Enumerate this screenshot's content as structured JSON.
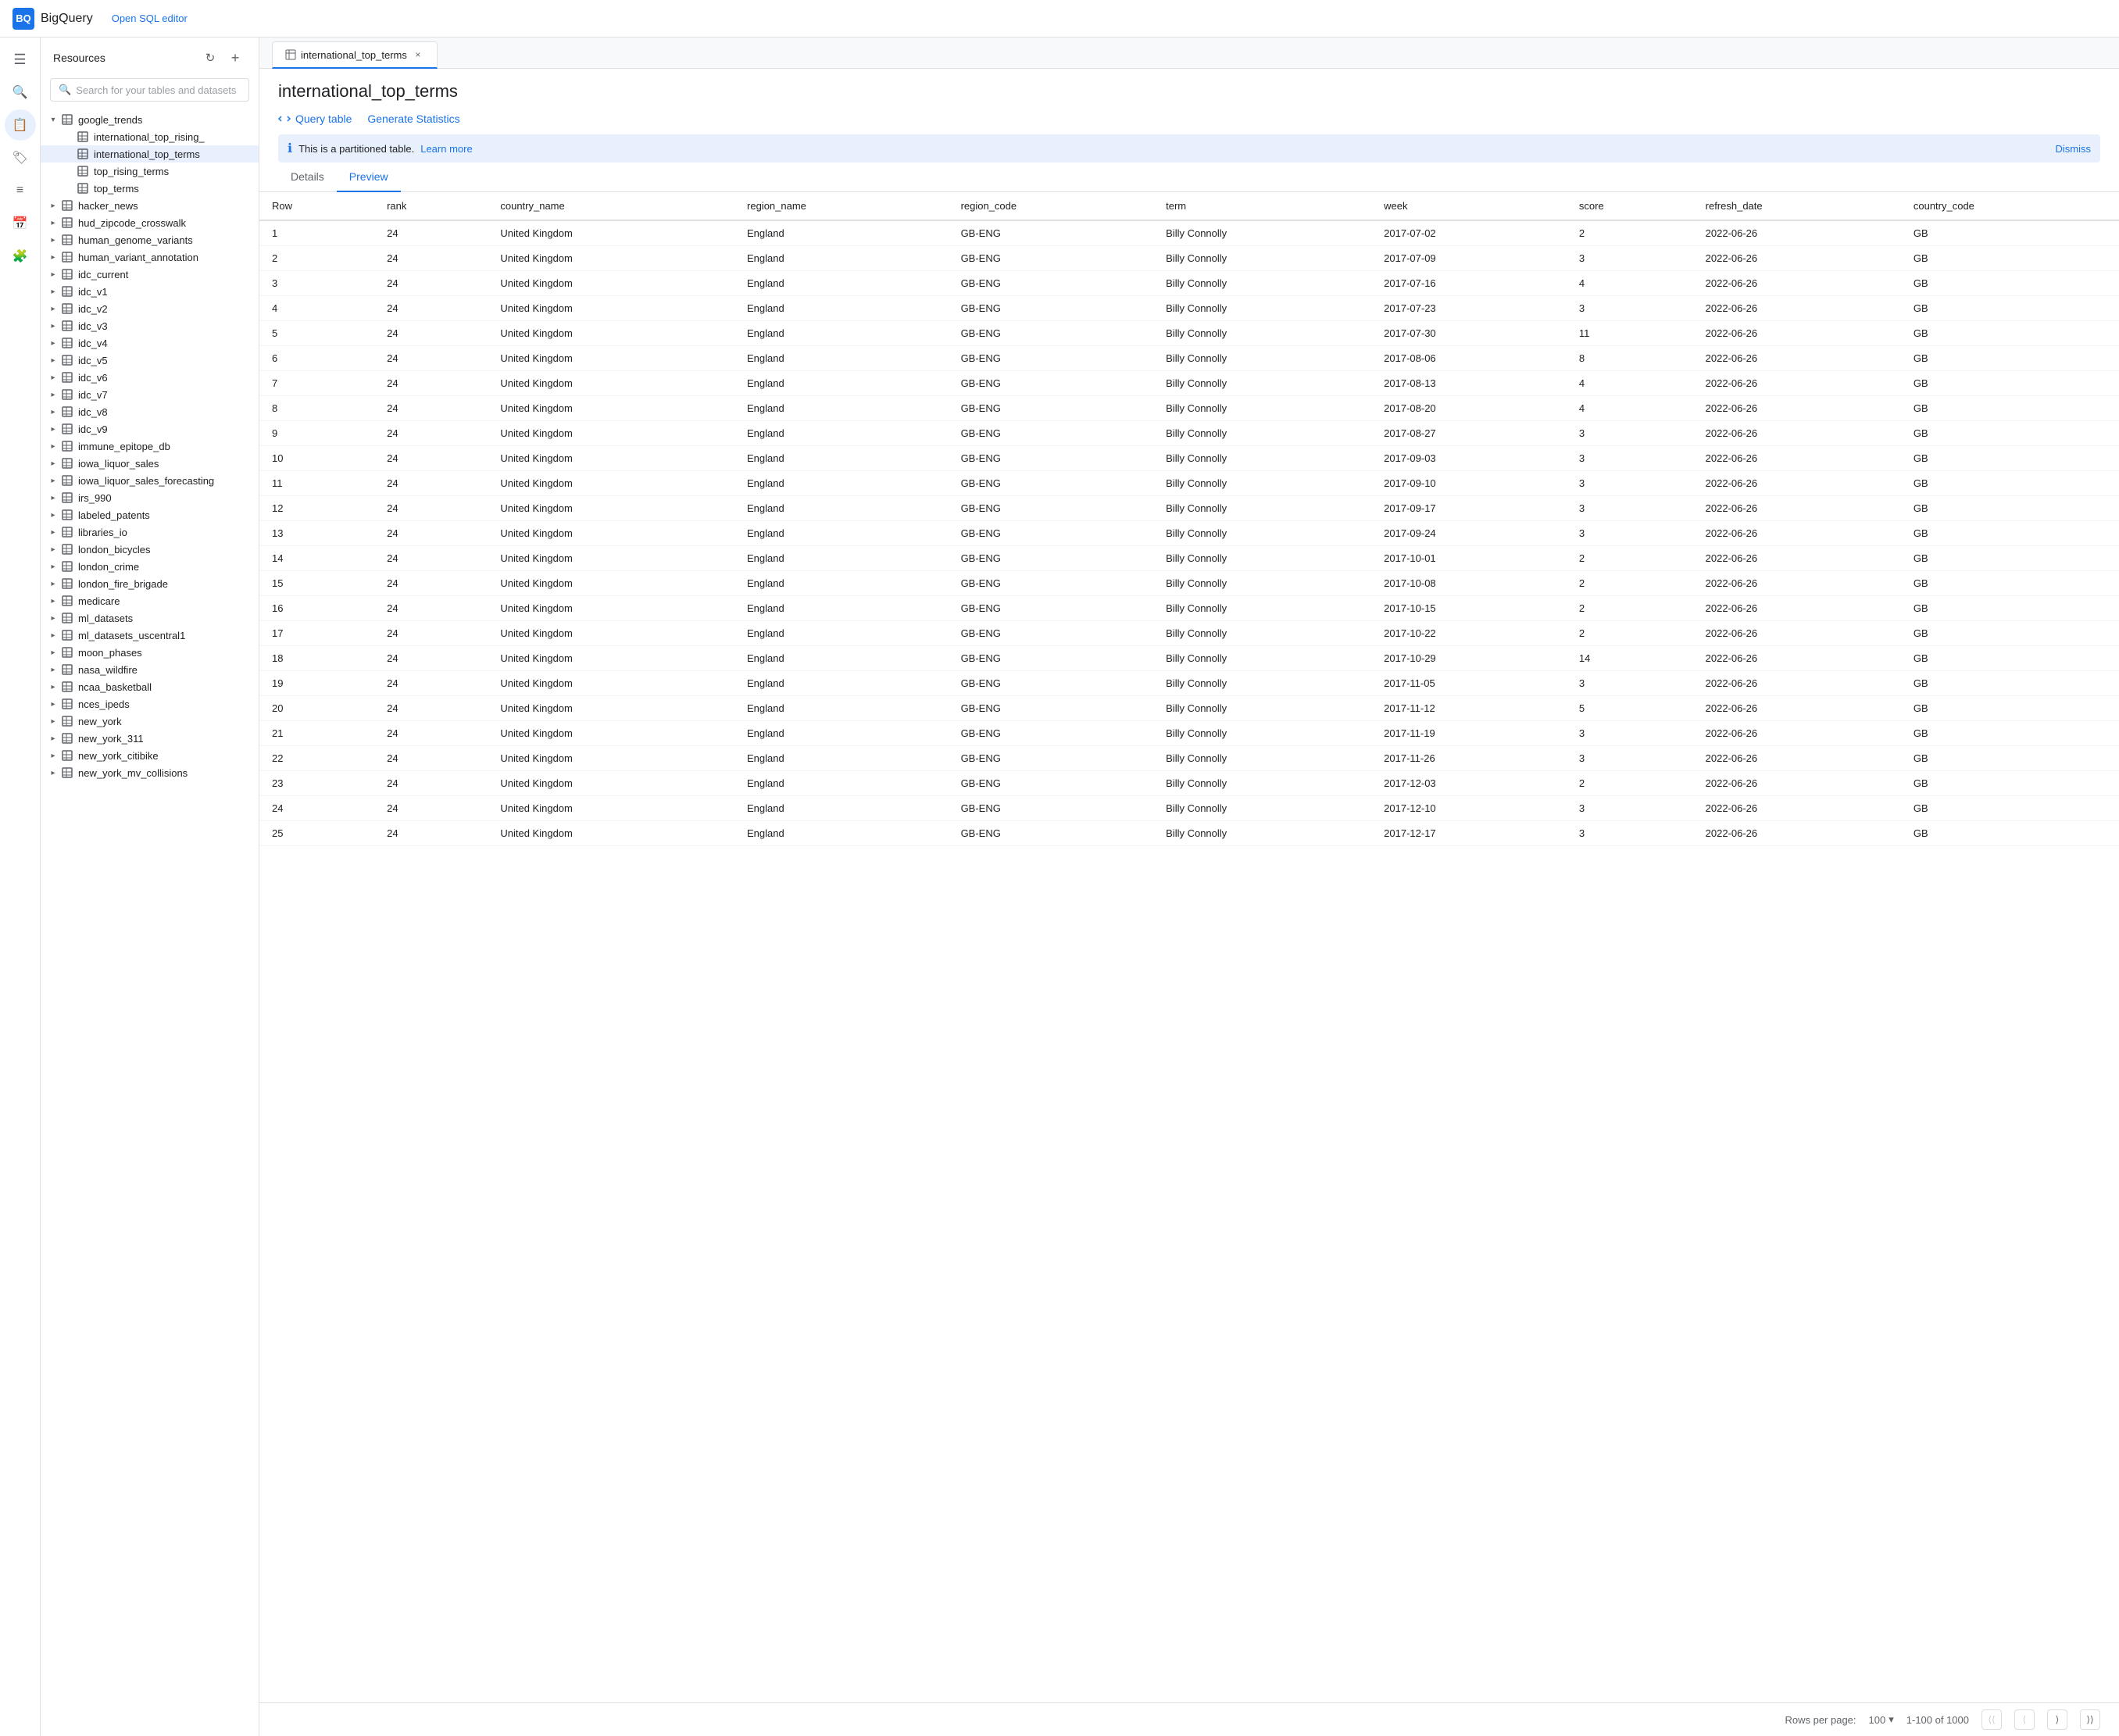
{
  "app": {
    "name": "BigQuery",
    "open_sql_label": "Open SQL editor"
  },
  "sidebar": {
    "resources_label": "Resources",
    "search_placeholder": "Search for your tables and datasets",
    "tree": [
      {
        "id": "google_trends",
        "label": "google_trends",
        "level": 1,
        "expanded": true,
        "type": "dataset"
      },
      {
        "id": "international_top_rising",
        "label": "international_top_rising_",
        "level": 2,
        "type": "table"
      },
      {
        "id": "international_top_terms",
        "label": "international_top_terms",
        "level": 2,
        "type": "table",
        "selected": true
      },
      {
        "id": "top_rising_terms",
        "label": "top_rising_terms",
        "level": 2,
        "type": "table"
      },
      {
        "id": "top_terms",
        "label": "top_terms",
        "level": 2,
        "type": "table"
      },
      {
        "id": "hacker_news",
        "label": "hacker_news",
        "level": 1,
        "type": "dataset"
      },
      {
        "id": "hud_zipcode_crosswalk",
        "label": "hud_zipcode_crosswalk",
        "level": 1,
        "type": "dataset"
      },
      {
        "id": "human_genome_variants",
        "label": "human_genome_variants",
        "level": 1,
        "type": "dataset"
      },
      {
        "id": "human_variant_annotation",
        "label": "human_variant_annotation",
        "level": 1,
        "type": "dataset"
      },
      {
        "id": "idc_current",
        "label": "idc_current",
        "level": 1,
        "type": "dataset"
      },
      {
        "id": "idc_v1",
        "label": "idc_v1",
        "level": 1,
        "type": "dataset"
      },
      {
        "id": "idc_v2",
        "label": "idc_v2",
        "level": 1,
        "type": "dataset"
      },
      {
        "id": "idc_v3",
        "label": "idc_v3",
        "level": 1,
        "type": "dataset"
      },
      {
        "id": "idc_v4",
        "label": "idc_v4",
        "level": 1,
        "type": "dataset"
      },
      {
        "id": "idc_v5",
        "label": "idc_v5",
        "level": 1,
        "type": "dataset"
      },
      {
        "id": "idc_v6",
        "label": "idc_v6",
        "level": 1,
        "type": "dataset"
      },
      {
        "id": "idc_v7",
        "label": "idc_v7",
        "level": 1,
        "type": "dataset"
      },
      {
        "id": "idc_v8",
        "label": "idc_v8",
        "level": 1,
        "type": "dataset"
      },
      {
        "id": "idc_v9",
        "label": "idc_v9",
        "level": 1,
        "type": "dataset"
      },
      {
        "id": "immune_epitope_db",
        "label": "immune_epitope_db",
        "level": 1,
        "type": "dataset"
      },
      {
        "id": "iowa_liquor_sales",
        "label": "iowa_liquor_sales",
        "level": 1,
        "type": "dataset"
      },
      {
        "id": "iowa_liquor_sales_forecasting",
        "label": "iowa_liquor_sales_forecasting",
        "level": 1,
        "type": "dataset"
      },
      {
        "id": "irs_990",
        "label": "irs_990",
        "level": 1,
        "type": "dataset"
      },
      {
        "id": "labeled_patents",
        "label": "labeled_patents",
        "level": 1,
        "type": "dataset"
      },
      {
        "id": "libraries_io",
        "label": "libraries_io",
        "level": 1,
        "type": "dataset"
      },
      {
        "id": "london_bicycles",
        "label": "london_bicycles",
        "level": 1,
        "type": "dataset"
      },
      {
        "id": "london_crime",
        "label": "london_crime",
        "level": 1,
        "type": "dataset"
      },
      {
        "id": "london_fire_brigade",
        "label": "london_fire_brigade",
        "level": 1,
        "type": "dataset"
      },
      {
        "id": "medicare",
        "label": "medicare",
        "level": 1,
        "type": "dataset"
      },
      {
        "id": "ml_datasets",
        "label": "ml_datasets",
        "level": 1,
        "type": "dataset"
      },
      {
        "id": "ml_datasets_uscentral1",
        "label": "ml_datasets_uscentral1",
        "level": 1,
        "type": "dataset"
      },
      {
        "id": "moon_phases",
        "label": "moon_phases",
        "level": 1,
        "type": "dataset"
      },
      {
        "id": "nasa_wildfire",
        "label": "nasa_wildfire",
        "level": 1,
        "type": "dataset"
      },
      {
        "id": "ncaa_basketball",
        "label": "ncaa_basketball",
        "level": 1,
        "type": "dataset"
      },
      {
        "id": "nces_ipeds",
        "label": "nces_ipeds",
        "level": 1,
        "type": "dataset"
      },
      {
        "id": "new_york",
        "label": "new_york",
        "level": 1,
        "type": "dataset"
      },
      {
        "id": "new_york_311",
        "label": "new_york_311",
        "level": 1,
        "type": "dataset"
      },
      {
        "id": "new_york_citibike",
        "label": "new_york_citibike",
        "level": 1,
        "type": "dataset"
      },
      {
        "id": "new_york_mv_collisions",
        "label": "new_york_mv_collisions",
        "level": 1,
        "type": "dataset"
      }
    ]
  },
  "tab": {
    "label": "international_top_terms",
    "close_label": "×"
  },
  "table_view": {
    "title": "international_top_terms",
    "query_table_label": "Query table",
    "generate_stats_label": "Generate Statistics",
    "info_message": "This is a partitioned table.",
    "learn_more_label": "Learn more",
    "dismiss_label": "Dismiss",
    "nav_tabs": [
      {
        "id": "details",
        "label": "Details"
      },
      {
        "id": "preview",
        "label": "Preview",
        "active": true
      }
    ],
    "columns": [
      "Row",
      "rank",
      "country_name",
      "region_name",
      "region_code",
      "term",
      "week",
      "score",
      "refresh_date",
      "country_code"
    ],
    "rows": [
      {
        "row": "1",
        "rank": "24",
        "country_name": "United Kingdom",
        "region_name": "England",
        "region_code": "GB-ENG",
        "term": "Billy Connolly",
        "week": "2017-07-02",
        "score": "2",
        "refresh_date": "2022-06-26",
        "country_code": "GB"
      },
      {
        "row": "2",
        "rank": "24",
        "country_name": "United Kingdom",
        "region_name": "England",
        "region_code": "GB-ENG",
        "term": "Billy Connolly",
        "week": "2017-07-09",
        "score": "3",
        "refresh_date": "2022-06-26",
        "country_code": "GB"
      },
      {
        "row": "3",
        "rank": "24",
        "country_name": "United Kingdom",
        "region_name": "England",
        "region_code": "GB-ENG",
        "term": "Billy Connolly",
        "week": "2017-07-16",
        "score": "4",
        "refresh_date": "2022-06-26",
        "country_code": "GB"
      },
      {
        "row": "4",
        "rank": "24",
        "country_name": "United Kingdom",
        "region_name": "England",
        "region_code": "GB-ENG",
        "term": "Billy Connolly",
        "week": "2017-07-23",
        "score": "3",
        "refresh_date": "2022-06-26",
        "country_code": "GB"
      },
      {
        "row": "5",
        "rank": "24",
        "country_name": "United Kingdom",
        "region_name": "England",
        "region_code": "GB-ENG",
        "term": "Billy Connolly",
        "week": "2017-07-30",
        "score": "11",
        "refresh_date": "2022-06-26",
        "country_code": "GB"
      },
      {
        "row": "6",
        "rank": "24",
        "country_name": "United Kingdom",
        "region_name": "England",
        "region_code": "GB-ENG",
        "term": "Billy Connolly",
        "week": "2017-08-06",
        "score": "8",
        "refresh_date": "2022-06-26",
        "country_code": "GB"
      },
      {
        "row": "7",
        "rank": "24",
        "country_name": "United Kingdom",
        "region_name": "England",
        "region_code": "GB-ENG",
        "term": "Billy Connolly",
        "week": "2017-08-13",
        "score": "4",
        "refresh_date": "2022-06-26",
        "country_code": "GB"
      },
      {
        "row": "8",
        "rank": "24",
        "country_name": "United Kingdom",
        "region_name": "England",
        "region_code": "GB-ENG",
        "term": "Billy Connolly",
        "week": "2017-08-20",
        "score": "4",
        "refresh_date": "2022-06-26",
        "country_code": "GB"
      },
      {
        "row": "9",
        "rank": "24",
        "country_name": "United Kingdom",
        "region_name": "England",
        "region_code": "GB-ENG",
        "term": "Billy Connolly",
        "week": "2017-08-27",
        "score": "3",
        "refresh_date": "2022-06-26",
        "country_code": "GB"
      },
      {
        "row": "10",
        "rank": "24",
        "country_name": "United Kingdom",
        "region_name": "England",
        "region_code": "GB-ENG",
        "term": "Billy Connolly",
        "week": "2017-09-03",
        "score": "3",
        "refresh_date": "2022-06-26",
        "country_code": "GB"
      },
      {
        "row": "11",
        "rank": "24",
        "country_name": "United Kingdom",
        "region_name": "England",
        "region_code": "GB-ENG",
        "term": "Billy Connolly",
        "week": "2017-09-10",
        "score": "3",
        "refresh_date": "2022-06-26",
        "country_code": "GB"
      },
      {
        "row": "12",
        "rank": "24",
        "country_name": "United Kingdom",
        "region_name": "England",
        "region_code": "GB-ENG",
        "term": "Billy Connolly",
        "week": "2017-09-17",
        "score": "3",
        "refresh_date": "2022-06-26",
        "country_code": "GB"
      },
      {
        "row": "13",
        "rank": "24",
        "country_name": "United Kingdom",
        "region_name": "England",
        "region_code": "GB-ENG",
        "term": "Billy Connolly",
        "week": "2017-09-24",
        "score": "3",
        "refresh_date": "2022-06-26",
        "country_code": "GB"
      },
      {
        "row": "14",
        "rank": "24",
        "country_name": "United Kingdom",
        "region_name": "England",
        "region_code": "GB-ENG",
        "term": "Billy Connolly",
        "week": "2017-10-01",
        "score": "2",
        "refresh_date": "2022-06-26",
        "country_code": "GB"
      },
      {
        "row": "15",
        "rank": "24",
        "country_name": "United Kingdom",
        "region_name": "England",
        "region_code": "GB-ENG",
        "term": "Billy Connolly",
        "week": "2017-10-08",
        "score": "2",
        "refresh_date": "2022-06-26",
        "country_code": "GB"
      },
      {
        "row": "16",
        "rank": "24",
        "country_name": "United Kingdom",
        "region_name": "England",
        "region_code": "GB-ENG",
        "term": "Billy Connolly",
        "week": "2017-10-15",
        "score": "2",
        "refresh_date": "2022-06-26",
        "country_code": "GB"
      },
      {
        "row": "17",
        "rank": "24",
        "country_name": "United Kingdom",
        "region_name": "England",
        "region_code": "GB-ENG",
        "term": "Billy Connolly",
        "week": "2017-10-22",
        "score": "2",
        "refresh_date": "2022-06-26",
        "country_code": "GB"
      },
      {
        "row": "18",
        "rank": "24",
        "country_name": "United Kingdom",
        "region_name": "England",
        "region_code": "GB-ENG",
        "term": "Billy Connolly",
        "week": "2017-10-29",
        "score": "14",
        "refresh_date": "2022-06-26",
        "country_code": "GB"
      },
      {
        "row": "19",
        "rank": "24",
        "country_name": "United Kingdom",
        "region_name": "England",
        "region_code": "GB-ENG",
        "term": "Billy Connolly",
        "week": "2017-11-05",
        "score": "3",
        "refresh_date": "2022-06-26",
        "country_code": "GB"
      },
      {
        "row": "20",
        "rank": "24",
        "country_name": "United Kingdom",
        "region_name": "England",
        "region_code": "GB-ENG",
        "term": "Billy Connolly",
        "week": "2017-11-12",
        "score": "5",
        "refresh_date": "2022-06-26",
        "country_code": "GB"
      },
      {
        "row": "21",
        "rank": "24",
        "country_name": "United Kingdom",
        "region_name": "England",
        "region_code": "GB-ENG",
        "term": "Billy Connolly",
        "week": "2017-11-19",
        "score": "3",
        "refresh_date": "2022-06-26",
        "country_code": "GB"
      },
      {
        "row": "22",
        "rank": "24",
        "country_name": "United Kingdom",
        "region_name": "England",
        "region_code": "GB-ENG",
        "term": "Billy Connolly",
        "week": "2017-11-26",
        "score": "3",
        "refresh_date": "2022-06-26",
        "country_code": "GB"
      },
      {
        "row": "23",
        "rank": "24",
        "country_name": "United Kingdom",
        "region_name": "England",
        "region_code": "GB-ENG",
        "term": "Billy Connolly",
        "week": "2017-12-03",
        "score": "2",
        "refresh_date": "2022-06-26",
        "country_code": "GB"
      },
      {
        "row": "24",
        "rank": "24",
        "country_name": "United Kingdom",
        "region_name": "England",
        "region_code": "GB-ENG",
        "term": "Billy Connolly",
        "week": "2017-12-10",
        "score": "3",
        "refresh_date": "2022-06-26",
        "country_code": "GB"
      },
      {
        "row": "25",
        "rank": "24",
        "country_name": "United Kingdom",
        "region_name": "England",
        "region_code": "GB-ENG",
        "term": "Billy Connolly",
        "week": "2017-12-17",
        "score": "3",
        "refresh_date": "2022-06-26",
        "country_code": "GB"
      }
    ],
    "footer": {
      "rows_per_page_label": "Rows per page:",
      "rows_per_page_value": "100",
      "pagination_info": "1-100 of 1000",
      "first_page_label": "⟨⟨",
      "prev_page_label": "⟨",
      "next_page_label": "⟩",
      "last_page_label": "⟩⟩"
    }
  }
}
